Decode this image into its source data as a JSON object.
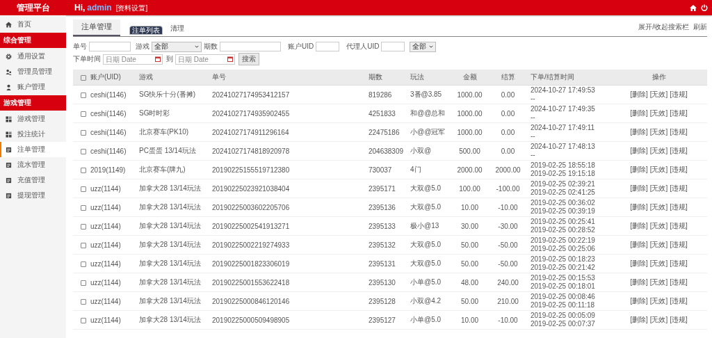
{
  "header": {
    "brand": "管理平台",
    "greeting": "Hi,",
    "user": "admin",
    "profile_link": "[资料设置]"
  },
  "sidebar": {
    "items": [
      {
        "kind": "link",
        "label": "首页",
        "selected": false
      },
      {
        "kind": "section",
        "label": "综合管理"
      },
      {
        "kind": "link",
        "label": "通用设置",
        "selected": false
      },
      {
        "kind": "link",
        "label": "管理员管理",
        "selected": false
      },
      {
        "kind": "link",
        "label": "账户管理",
        "selected": false
      },
      {
        "kind": "section",
        "label": "游戏管理"
      },
      {
        "kind": "link",
        "label": "游戏管理",
        "selected": false
      },
      {
        "kind": "link",
        "label": "投注统计",
        "selected": false
      },
      {
        "kind": "link",
        "label": "注单管理",
        "selected": true
      },
      {
        "kind": "link",
        "label": "流水管理",
        "selected": false
      },
      {
        "kind": "link",
        "label": "充值管理",
        "selected": false
      },
      {
        "kind": "link",
        "label": "提现管理",
        "selected": false
      }
    ]
  },
  "page_title": "注单管理",
  "tabs": [
    {
      "label": "注单列表",
      "selected": true
    },
    {
      "label": "清理",
      "selected": false
    }
  ],
  "toolbar_links": [
    "展开/收起搜索栏",
    "刷新"
  ],
  "filters": {
    "order_no": {
      "label": "单号"
    },
    "game": {
      "label": "游戏",
      "value": "全部"
    },
    "period": {
      "label": "期数"
    },
    "account_uid": {
      "label": "账户UID"
    },
    "agent_uid": {
      "label": "代理人UID"
    },
    "scope": {
      "value": "全部"
    },
    "time": {
      "label": "下单时间",
      "from_placeholder": "日期 Date",
      "to_label": "到",
      "to_placeholder": "日期 Date"
    },
    "search_button": "搜索"
  },
  "table": {
    "select_all": {
      "checked": false
    },
    "columns": [
      "账户(UID)",
      "游戏",
      "单号",
      "期数",
      "玩法",
      "金额",
      "结算",
      "下单/结算时间",
      "操作"
    ],
    "rows": [
      {
        "checked": false,
        "account": "ceshi(1146)",
        "game": "SG快乐十分(番摊)",
        "order_no": "20241027174953412157",
        "period": "819286",
        "play": "3番@3.85",
        "amount": "1000.00",
        "settle": "0.00",
        "time": [
          "2024-10-27 17:49:53",
          "--"
        ],
        "actions": [
          "[删除]",
          "[无效]",
          "[违规]"
        ]
      },
      {
        "checked": false,
        "account": "ceshi(1146)",
        "game": "SG时时彩",
        "order_no": "20241027174935902455",
        "period": "4251833",
        "play": "和@@总和",
        "amount": "1000.00",
        "settle": "0.00",
        "time": [
          "2024-10-27 17:49:35",
          "--"
        ],
        "actions": [
          "[删除]",
          "[无效]",
          "[违规]"
        ]
      },
      {
        "checked": false,
        "account": "ceshi(1146)",
        "game": "北京赛车(PK10)",
        "order_no": "20241027174911296164",
        "period": "22475186",
        "play": "小@@冠军",
        "amount": "1000.00",
        "settle": "0.00",
        "time": [
          "2024-10-27 17:49:11",
          "--"
        ],
        "actions": [
          "[删除]",
          "[无效]",
          "[违规]"
        ]
      },
      {
        "checked": false,
        "account": "ceshi(1146)",
        "game": "PC蛋蛋 13/14玩法",
        "order_no": "20241027174818920978",
        "period": "204638309",
        "play": "小双@",
        "amount": "500.00",
        "settle": "0.00",
        "time": [
          "2024-10-27 17:48:13",
          "--"
        ],
        "actions": [
          "[删除]",
          "[无效]",
          "[违规]"
        ]
      },
      {
        "checked": false,
        "account": "2019(1149)",
        "game": "北京赛车(牌九)",
        "order_no": "20190225155519712380",
        "period": "730037",
        "play": "4门",
        "amount": "2000.00",
        "settle": "2000.00",
        "time": [
          "2019-02-25 18:55:18",
          "2019-02-25 19:15:18"
        ],
        "actions": [
          "[删除]",
          "[无效]",
          "[违规]"
        ]
      },
      {
        "checked": false,
        "account": "uzz(1144)",
        "game": "加拿大28 13/14玩法",
        "order_no": "20190225023921038404",
        "period": "2395171",
        "play": "大双@5.0",
        "amount": "100.00",
        "settle": "-100.00",
        "time": [
          "2019-02-25 02:39:21",
          "2019-02-25 02:41:25"
        ],
        "actions": [
          "[删除]",
          "[无效]",
          "[违规]"
        ]
      },
      {
        "checked": false,
        "account": "uzz(1144)",
        "game": "加拿大28 13/14玩法",
        "order_no": "20190225003602205706",
        "period": "2395136",
        "play": "大双@5.0",
        "amount": "10.00",
        "settle": "-10.00",
        "time": [
          "2019-02-25 00:36:02",
          "2019-02-25 00:39:19"
        ],
        "actions": [
          "[删除]",
          "[无效]",
          "[违规]"
        ]
      },
      {
        "checked": false,
        "account": "uzz(1144)",
        "game": "加拿大28 13/14玩法",
        "order_no": "20190225002541913271",
        "period": "2395133",
        "play": "极小@13",
        "amount": "30.00",
        "settle": "-30.00",
        "time": [
          "2019-02-25 00:25:41",
          "2019-02-25 00:28:52"
        ],
        "actions": [
          "[删除]",
          "[无效]",
          "[违规]"
        ]
      },
      {
        "checked": false,
        "account": "uzz(1144)",
        "game": "加拿大28 13/14玩法",
        "order_no": "20190225002219274933",
        "period": "2395132",
        "play": "大双@5.0",
        "amount": "50.00",
        "settle": "-50.00",
        "time": [
          "2019-02-25 00:22:19",
          "2019-02-25 00:25:06"
        ],
        "actions": [
          "[删除]",
          "[无效]",
          "[违规]"
        ]
      },
      {
        "checked": false,
        "account": "uzz(1144)",
        "game": "加拿大28 13/14玩法",
        "order_no": "20190225001823306019",
        "period": "2395131",
        "play": "大双@5.0",
        "amount": "50.00",
        "settle": "-50.00",
        "time": [
          "2019-02-25 00:18:23",
          "2019-02-25 00:21:42"
        ],
        "actions": [
          "[删除]",
          "[无效]",
          "[违规]"
        ]
      },
      {
        "checked": false,
        "account": "uzz(1144)",
        "game": "加拿大28 13/14玩法",
        "order_no": "20190225001553622418",
        "period": "2395130",
        "play": "小单@5.0",
        "amount": "48.00",
        "settle": "240.00",
        "time": [
          "2019-02-25 00:15:53",
          "2019-02-25 00:18:01"
        ],
        "actions": [
          "[删除]",
          "[无效]",
          "[违规]"
        ]
      },
      {
        "checked": false,
        "account": "uzz(1144)",
        "game": "加拿大28 13/14玩法",
        "order_no": "20190225000846120146",
        "period": "2395128",
        "play": "小双@4.2",
        "amount": "50.00",
        "settle": "210.00",
        "time": [
          "2019-02-25 00:08:46",
          "2019-02-25 00:11:18"
        ],
        "actions": [
          "[删除]",
          "[无效]",
          "[违规]"
        ]
      },
      {
        "checked": false,
        "account": "uzz(1144)",
        "game": "加拿大28 13/14玩法",
        "order_no": "20190225000509498905",
        "period": "2395127",
        "play": "小单@5.0",
        "amount": "10.00",
        "settle": "-10.00",
        "time": [
          "2019-02-25 00:05:09",
          "2019-02-25 00:07:37"
        ],
        "actions": [
          "[删除]",
          "[无效]",
          "[违规]"
        ]
      }
    ]
  }
}
